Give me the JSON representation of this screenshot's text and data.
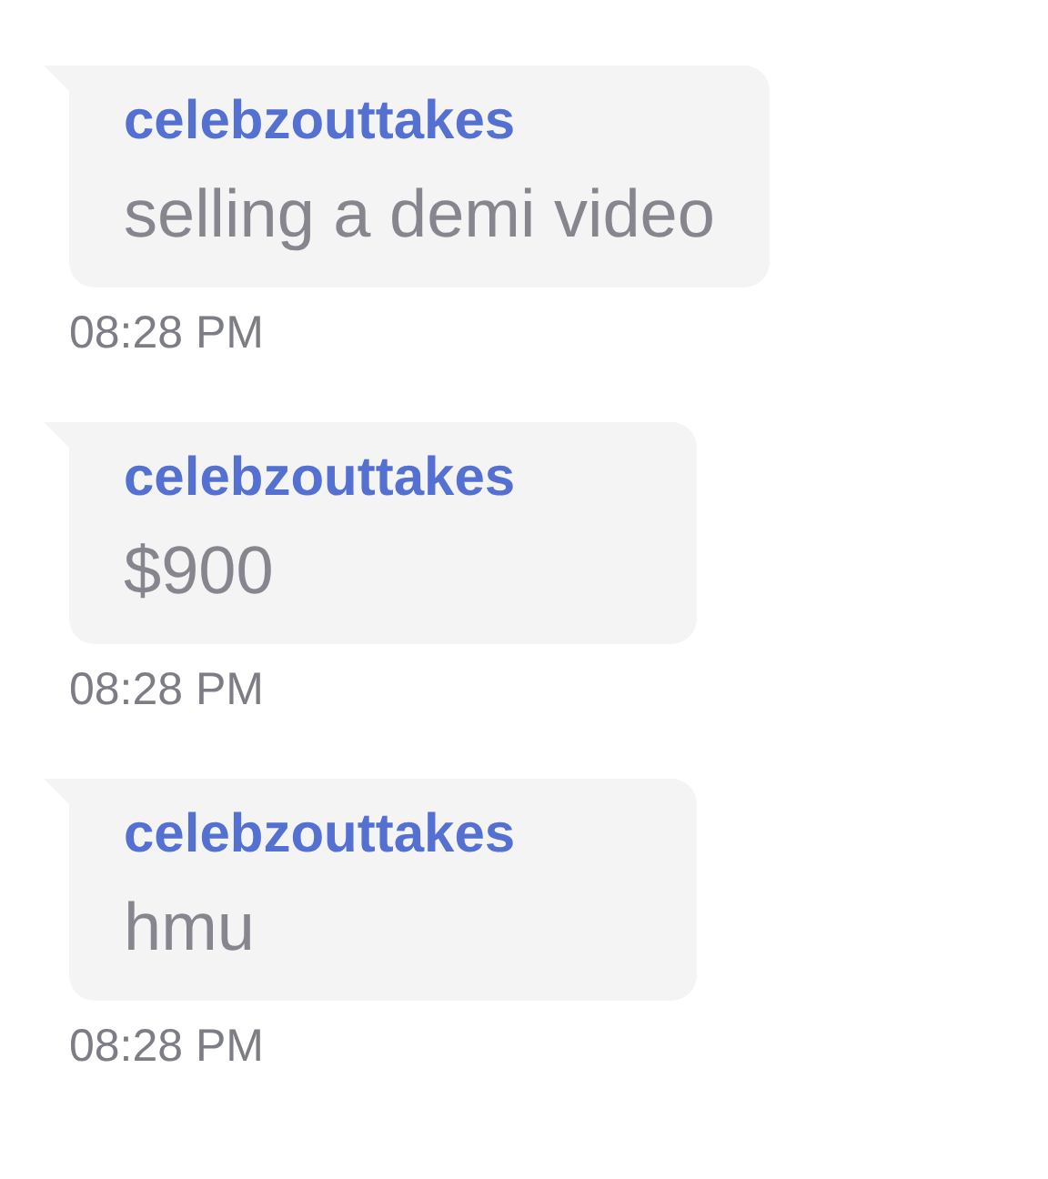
{
  "messages": [
    {
      "sender": "celebzouttakes",
      "text": "selling a demi video",
      "time": "08:28 PM"
    },
    {
      "sender": "celebzouttakes",
      "text": "$900",
      "time": "08:28 PM"
    },
    {
      "sender": "celebzouttakes",
      "text": "hmu",
      "time": "08:28 PM"
    }
  ]
}
